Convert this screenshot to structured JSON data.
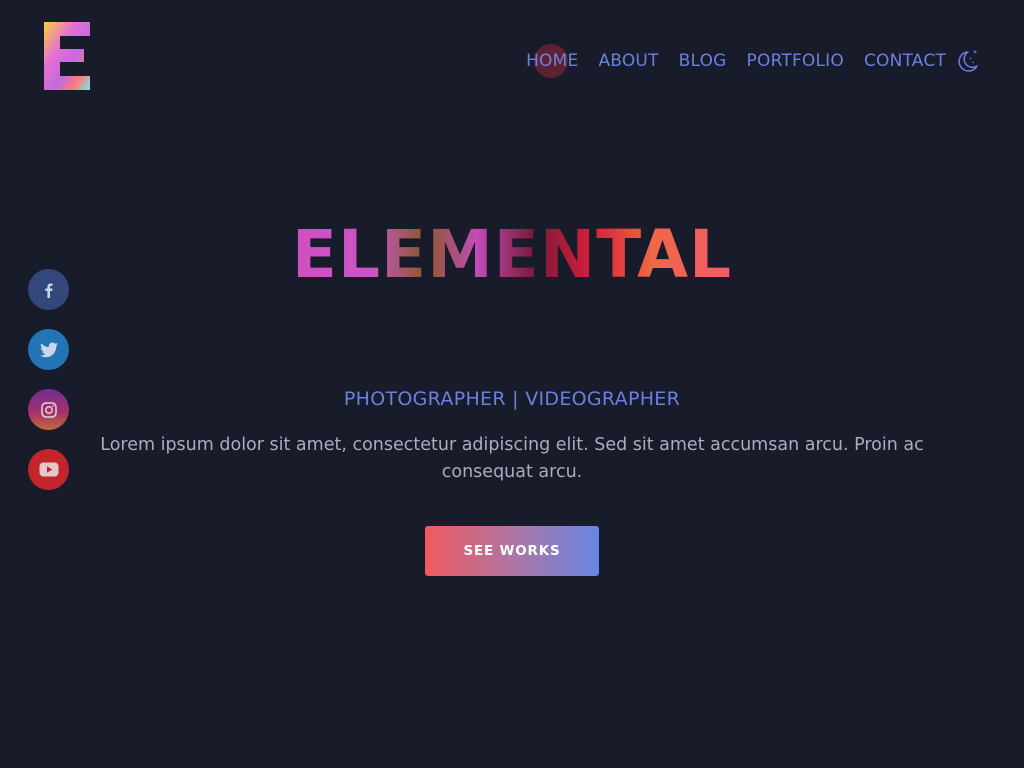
{
  "brand": {
    "logo_letter": "E",
    "colors": [
      "#f7d33c",
      "#e76fd2",
      "#6ef0e8",
      "#c06be0",
      "#ff7b7b"
    ]
  },
  "nav": {
    "items": [
      {
        "label": "HOME",
        "active": true
      },
      {
        "label": "ABOUT",
        "active": false
      },
      {
        "label": "BLOG",
        "active": false
      },
      {
        "label": "PORTFOLIO",
        "active": false
      },
      {
        "label": "CONTACT",
        "active": false
      }
    ],
    "theme_toggle_icon": "moon-stars-icon",
    "accent": "#6a80e0"
  },
  "socials": [
    {
      "name": "facebook",
      "icon": "facebook-icon",
      "color": "#33477a"
    },
    {
      "name": "twitter",
      "icon": "twitter-icon",
      "color": "#2274b4"
    },
    {
      "name": "instagram",
      "icon": "instagram-icon",
      "color": "#a3306c"
    },
    {
      "name": "youtube",
      "icon": "youtube-icon",
      "color": "#c2262c"
    }
  ],
  "hero": {
    "title": "ELEMENTAL",
    "subtitle": "PHOTOGRAPHER | VIDEOGRAPHER",
    "description": "Lorem ipsum dolor sit amet, consectetur adipiscing elit. Sed sit amet accumsan arcu. Proin ac consequat arcu.",
    "cta_label": "SEE WORKS"
  },
  "theme": {
    "background": "#181b29",
    "text_muted": "#a9adbf",
    "button_gradient": [
      "#f05a5f",
      "#6885e4"
    ]
  }
}
